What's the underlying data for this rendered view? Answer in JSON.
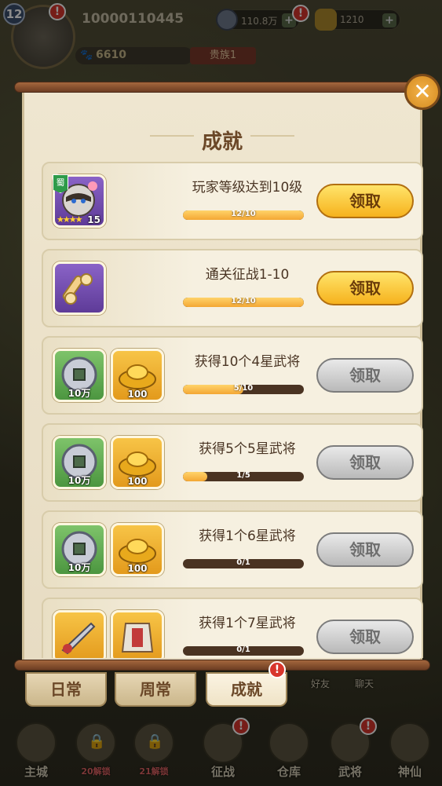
{
  "hud": {
    "level": "12",
    "player_id": "10000110445",
    "power": "6610",
    "vip": "贵族1",
    "coins": "110.8万",
    "gold": "1210"
  },
  "dialog": {
    "title": "成就",
    "claim_label": "领取",
    "achievements": [
      {
        "task": "玩家等级达到10级",
        "progress_text": "12/10",
        "progress": 1.0,
        "claimable": true,
        "rewards": [
          {
            "kind": "hero",
            "faction": "蜀",
            "stars": "★★★★",
            "count": "15",
            "color": "purple",
            "icon": "cat-hero-icon"
          }
        ]
      },
      {
        "task": "通关征战1-10",
        "progress_text": "12/10",
        "progress": 1.0,
        "claimable": true,
        "rewards": [
          {
            "kind": "scroll",
            "color": "purple",
            "icon": "scroll-icon"
          }
        ]
      },
      {
        "task": "获得10个4星武将",
        "progress_text": "5/10",
        "progress": 0.5,
        "claimable": false,
        "rewards": [
          {
            "kind": "coin",
            "count": "10万",
            "color": "green",
            "icon": "coin-icon"
          },
          {
            "kind": "ingot",
            "count": "100",
            "color": "gold",
            "icon": "gold-ingot-icon"
          }
        ]
      },
      {
        "task": "获得5个5星武将",
        "progress_text": "1/5",
        "progress": 0.2,
        "claimable": false,
        "rewards": [
          {
            "kind": "coin",
            "count": "10万",
            "color": "green",
            "icon": "coin-icon"
          },
          {
            "kind": "ingot",
            "count": "100",
            "color": "gold",
            "icon": "gold-ingot-icon"
          }
        ]
      },
      {
        "task": "获得1个6星武将",
        "progress_text": "0/1",
        "progress": 0.0,
        "claimable": false,
        "rewards": [
          {
            "kind": "coin",
            "count": "10万",
            "color": "green",
            "icon": "coin-icon"
          },
          {
            "kind": "ingot",
            "count": "100",
            "color": "gold",
            "icon": "gold-ingot-icon"
          }
        ]
      },
      {
        "task": "获得1个7星武将",
        "progress_text": "0/1",
        "progress": 0.0,
        "claimable": false,
        "rewards": [
          {
            "kind": "weapon",
            "color": "gold",
            "icon": "weapon-icon"
          },
          {
            "kind": "armor",
            "color": "gold",
            "icon": "armor-icon"
          }
        ]
      }
    ]
  },
  "tabs": {
    "daily": "日常",
    "weekly": "周常",
    "achievement": "成就"
  },
  "side": {
    "friends": "好友",
    "chat": "聊天"
  },
  "nav": {
    "main_city": "主城",
    "locked1_sub": "20解锁",
    "locked2_sub": "21解锁",
    "campaign": "征战",
    "warehouse": "仓库",
    "heroes": "武将",
    "immortal": "神仙"
  },
  "alert_mark": "!",
  "colors": {
    "claim_active": "#f6b21d",
    "claim_inactive": "#b9b9b9",
    "progress": "#f4a734"
  }
}
